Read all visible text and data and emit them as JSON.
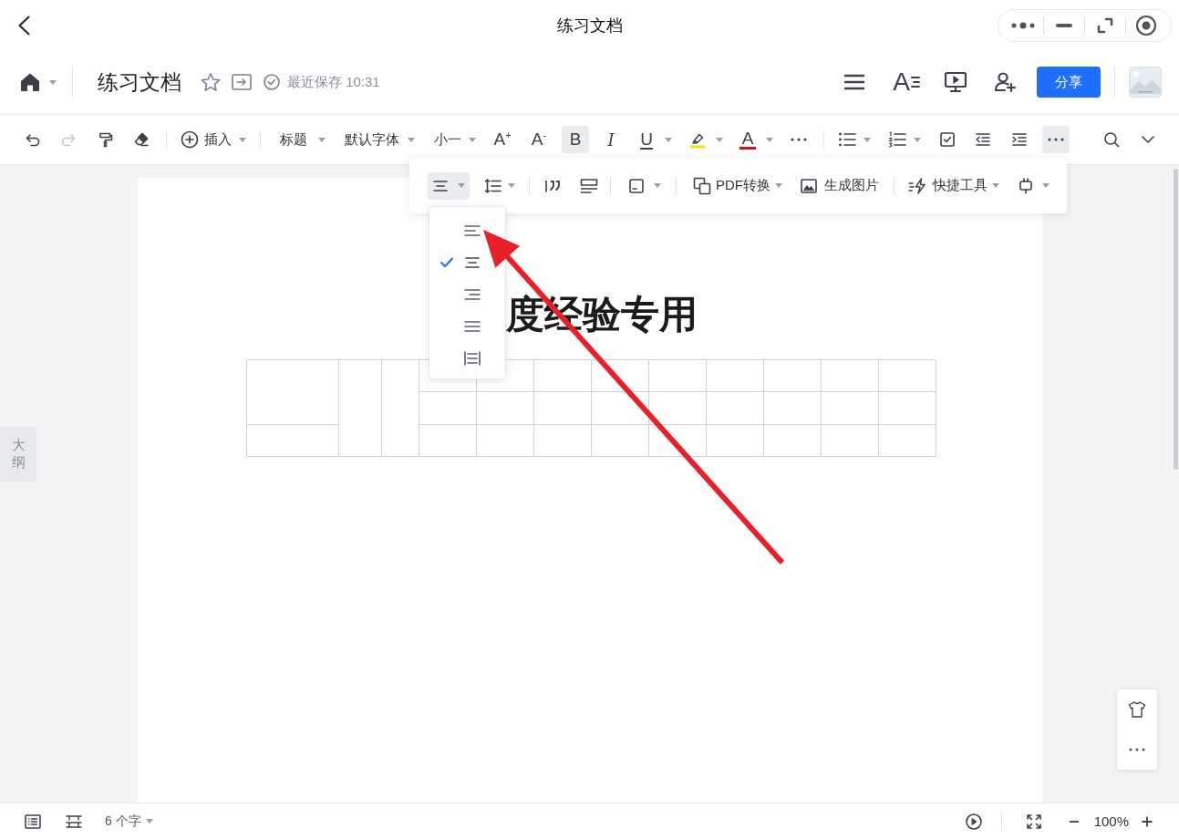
{
  "title_bar": {
    "title": "练习文档"
  },
  "header": {
    "doc_title": "练习文档",
    "save_status": "最近保存 10:31",
    "text_format": {
      "label": "A"
    },
    "share_button": "分享"
  },
  "toolbar": {
    "undo": {
      "disabled": false
    },
    "redo": {
      "disabled": true
    },
    "insert": {
      "label": "插入"
    },
    "heading": {
      "label": "标题"
    },
    "font": {
      "label": "默认字体"
    },
    "size": {
      "label": "小一"
    },
    "grow": {
      "label": "A$^{+}$"
    },
    "shrink": {
      "label": "A$^{-}$"
    },
    "bold": {
      "label": "B",
      "selected": true
    },
    "italic": {
      "label": "I",
      "selected": false
    },
    "underline": {
      "label": "U",
      "selected": false
    },
    "font_color": {
      "label": "A"
    },
    "more": {
      "selected": true
    }
  },
  "floating_toolbar": {
    "align": {
      "selected": true
    },
    "pdf": {
      "label": "PDF转换"
    },
    "image": {
      "label": "生成图片"
    },
    "tools": {
      "label": "快捷工具"
    }
  },
  "align_menu": {
    "items": [
      {
        "kind": "left",
        "selected": false
      },
      {
        "kind": "center",
        "selected": true
      },
      {
        "kind": "right",
        "selected": false
      },
      {
        "kind": "justify",
        "selected": false
      },
      {
        "kind": "distributed",
        "selected": false
      }
    ]
  },
  "document": {
    "heading": "度经验专用"
  },
  "outline_tab": {
    "label": "大纲"
  },
  "status_bar": {
    "word_count": "6 个字",
    "zoom": "100%"
  }
}
